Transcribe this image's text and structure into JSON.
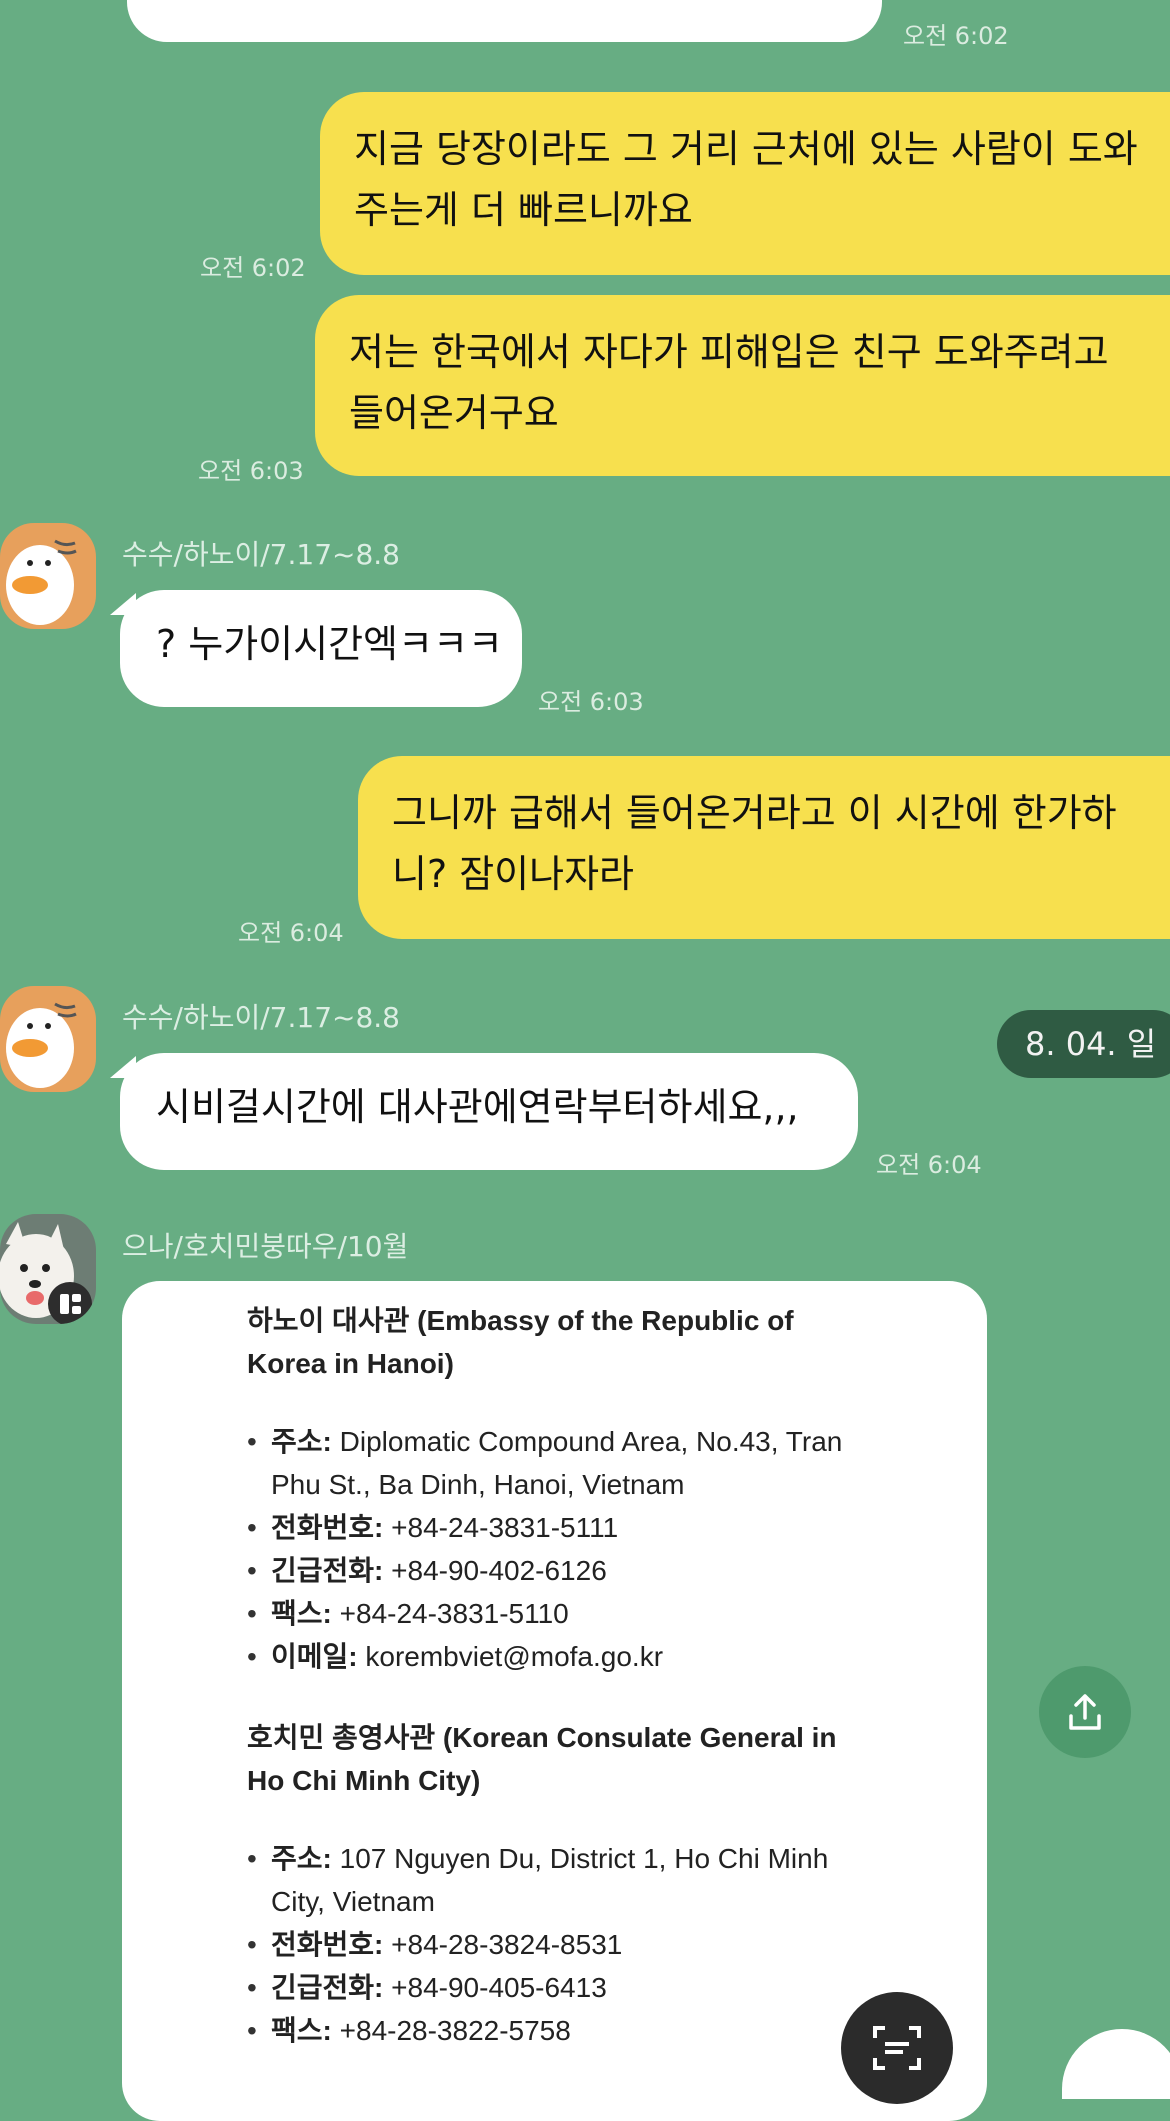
{
  "messages": {
    "m0_time": "오전 6:02",
    "m1": {
      "line1": "지금 당장이라도 그 거리 근처에 있는 사람이 도와",
      "line2": "주는게 더 빠르니까요",
      "time": "오전 6:02"
    },
    "m2": {
      "line1": "저는 한국에서 자다가 피해입은 친구 도와주려고",
      "line2": "들어온거구요",
      "time": "오전 6:03"
    },
    "m3": {
      "sender": "수수/하노이/7.17~8.8",
      "text": "? 누가이시간엑ㅋㅋㅋ",
      "time": "오전 6:03"
    },
    "m4": {
      "line1": "그니까 급해서 들어온거라고 이 시간에 한가하",
      "line2": "니? 잠이나자라",
      "time": "오전 6:04"
    },
    "m5": {
      "sender": "수수/하노이/7.17~8.8",
      "text": "시비걸시간에 대사관에연락부터하세요,,,",
      "time": "오전 6:04"
    },
    "m6": {
      "sender": "으나/호치민붕따우/10월"
    }
  },
  "date_pill": "8. 04. 일",
  "card": {
    "hanoi_title": "하노이 대사관 (Embassy of the Republic of",
    "hanoi_title2": "Korea in Hanoi)",
    "hanoi_items": [
      {
        "label": "주소:",
        "value": " Diplomatic Compound Area, No.43, Tran",
        "cont": "Phu St., Ba Dinh, Hanoi, Vietnam"
      },
      {
        "label": "전화번호:",
        "value": " +84-24-3831-5111"
      },
      {
        "label": "긴급전화:",
        "value": " +84-90-402-6126"
      },
      {
        "label": "팩스:",
        "value": " +84-24-3831-5110"
      },
      {
        "label": "이메일:",
        "value": " korembviet@mofa.go.kr"
      }
    ],
    "hcm_title": "호치민 총영사관 (Korean Consulate General in",
    "hcm_title2": "Ho Chi Minh City)",
    "hcm_items": [
      {
        "label": "주소:",
        "value": " 107 Nguyen Du, District 1, Ho Chi Minh",
        "cont": "City, Vietnam"
      },
      {
        "label": "전화번호:",
        "value": " +84-28-3824-8531"
      },
      {
        "label": "긴급전화:",
        "value": " +84-90-405-6413"
      },
      {
        "label": "팩스:",
        "value": " +84-28-3822-5758"
      }
    ]
  },
  "icons": [
    "duck-avatar",
    "dog-avatar",
    "share-icon",
    "scan-text-icon"
  ],
  "colors": {
    "background": "#67ad83",
    "my_bubble": "#f7e04e",
    "other_bubble": "#ffffff",
    "date_pill": "#2f5b43"
  }
}
